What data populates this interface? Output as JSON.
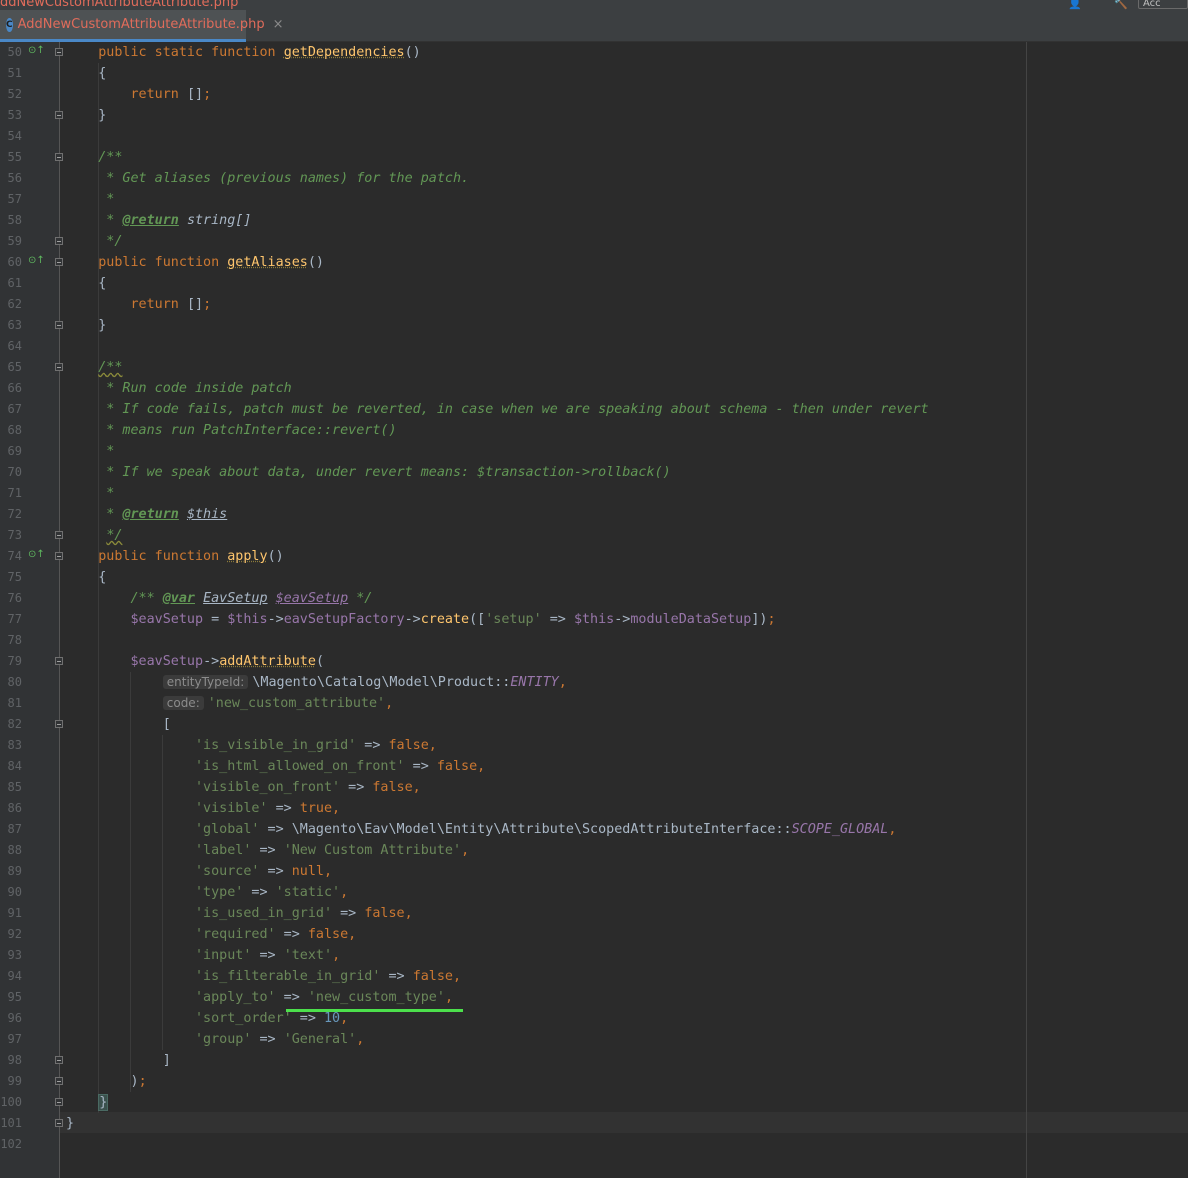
{
  "window": {
    "title_partial": "ddNewCustomAttributeAttribute.php",
    "top_right_label": "Acc"
  },
  "tab": {
    "icon_letter": "C",
    "label": "AddNewCustomAttributeAttribute.php",
    "close": "×"
  },
  "gutter_marks": {
    "override": "⊙↑"
  },
  "lines": [
    {
      "n": "50",
      "code": "    public static function getDependencies()"
    },
    {
      "n": "51",
      "code": "    {"
    },
    {
      "n": "52",
      "code": "        return [];"
    },
    {
      "n": "53",
      "code": "    }"
    },
    {
      "n": "54",
      "code": ""
    },
    {
      "n": "55",
      "code": "    /**"
    },
    {
      "n": "56",
      "code": "     * Get aliases (previous names) for the patch."
    },
    {
      "n": "57",
      "code": "     *"
    },
    {
      "n": "58",
      "code": "     * @return string[]"
    },
    {
      "n": "59",
      "code": "     */"
    },
    {
      "n": "60",
      "code": "    public function getAliases()"
    },
    {
      "n": "61",
      "code": "    {"
    },
    {
      "n": "62",
      "code": "        return [];"
    },
    {
      "n": "63",
      "code": "    }"
    },
    {
      "n": "64",
      "code": ""
    },
    {
      "n": "65",
      "code": "    /**"
    },
    {
      "n": "66",
      "code": "     * Run code inside patch"
    },
    {
      "n": "67",
      "code": "     * If code fails, patch must be reverted, in case when we are speaking about schema - then under revert"
    },
    {
      "n": "68",
      "code": "     * means run PatchInterface::revert()"
    },
    {
      "n": "69",
      "code": "     *"
    },
    {
      "n": "70",
      "code": "     * If we speak about data, under revert means: $transaction->rollback()"
    },
    {
      "n": "71",
      "code": "     *"
    },
    {
      "n": "72",
      "code": "     * @return $this"
    },
    {
      "n": "73",
      "code": "     */"
    },
    {
      "n": "74",
      "code": "    public function apply()"
    },
    {
      "n": "75",
      "code": "    {"
    },
    {
      "n": "76",
      "code": "        /** @var EavSetup $eavSetup */"
    },
    {
      "n": "77",
      "code": "        $eavSetup = $this->eavSetupFactory->create(['setup' => $this->moduleDataSetup]);"
    },
    {
      "n": "78",
      "code": ""
    },
    {
      "n": "79",
      "code": "        $eavSetup->addAttribute("
    },
    {
      "n": "80",
      "code": "            \\Magento\\Catalog\\Model\\Product::ENTITY,"
    },
    {
      "n": "81",
      "code": "            'new_custom_attribute',"
    },
    {
      "n": "82",
      "code": "            ["
    },
    {
      "n": "83",
      "code": "                'is_visible_in_grid' => false,"
    },
    {
      "n": "84",
      "code": "                'is_html_allowed_on_front' => false,"
    },
    {
      "n": "85",
      "code": "                'visible_on_front' => false,"
    },
    {
      "n": "86",
      "code": "                'visible' => true,"
    },
    {
      "n": "87",
      "code": "                'global' => \\Magento\\Eav\\Model\\Entity\\Attribute\\ScopedAttributeInterface::SCOPE_GLOBAL,"
    },
    {
      "n": "88",
      "code": "                'label' => 'New Custom Attribute',"
    },
    {
      "n": "89",
      "code": "                'source' => null,"
    },
    {
      "n": "90",
      "code": "                'type' => 'static',"
    },
    {
      "n": "91",
      "code": "                'is_used_in_grid' => false,"
    },
    {
      "n": "92",
      "code": "                'required' => false,"
    },
    {
      "n": "93",
      "code": "                'input' => 'text',"
    },
    {
      "n": "94",
      "code": "                'is_filterable_in_grid' => false,"
    },
    {
      "n": "95",
      "code": "                'apply_to' => 'new_custom_type',"
    },
    {
      "n": "96",
      "code": "                'sort_order' => 10,"
    },
    {
      "n": "97",
      "code": "                'group' => 'General',"
    },
    {
      "n": "98",
      "code": "            ]"
    },
    {
      "n": "99",
      "code": "        );"
    },
    {
      "n": "100",
      "code": "    }"
    },
    {
      "n": "101",
      "code": "}"
    },
    {
      "n": "102",
      "code": ""
    }
  ],
  "param_hints": {
    "entity_type_id": "entityTypeId:",
    "code": "code:"
  },
  "colors": {
    "background": "#2b2b2b",
    "keyword": "#cc7832",
    "function": "#ffc66d",
    "variable": "#9876aa",
    "string": "#6a8759",
    "number": "#6897bb",
    "comment": "#629755",
    "tab_accent": "#4a88c7",
    "highlight_underline": "#4ce04c"
  }
}
